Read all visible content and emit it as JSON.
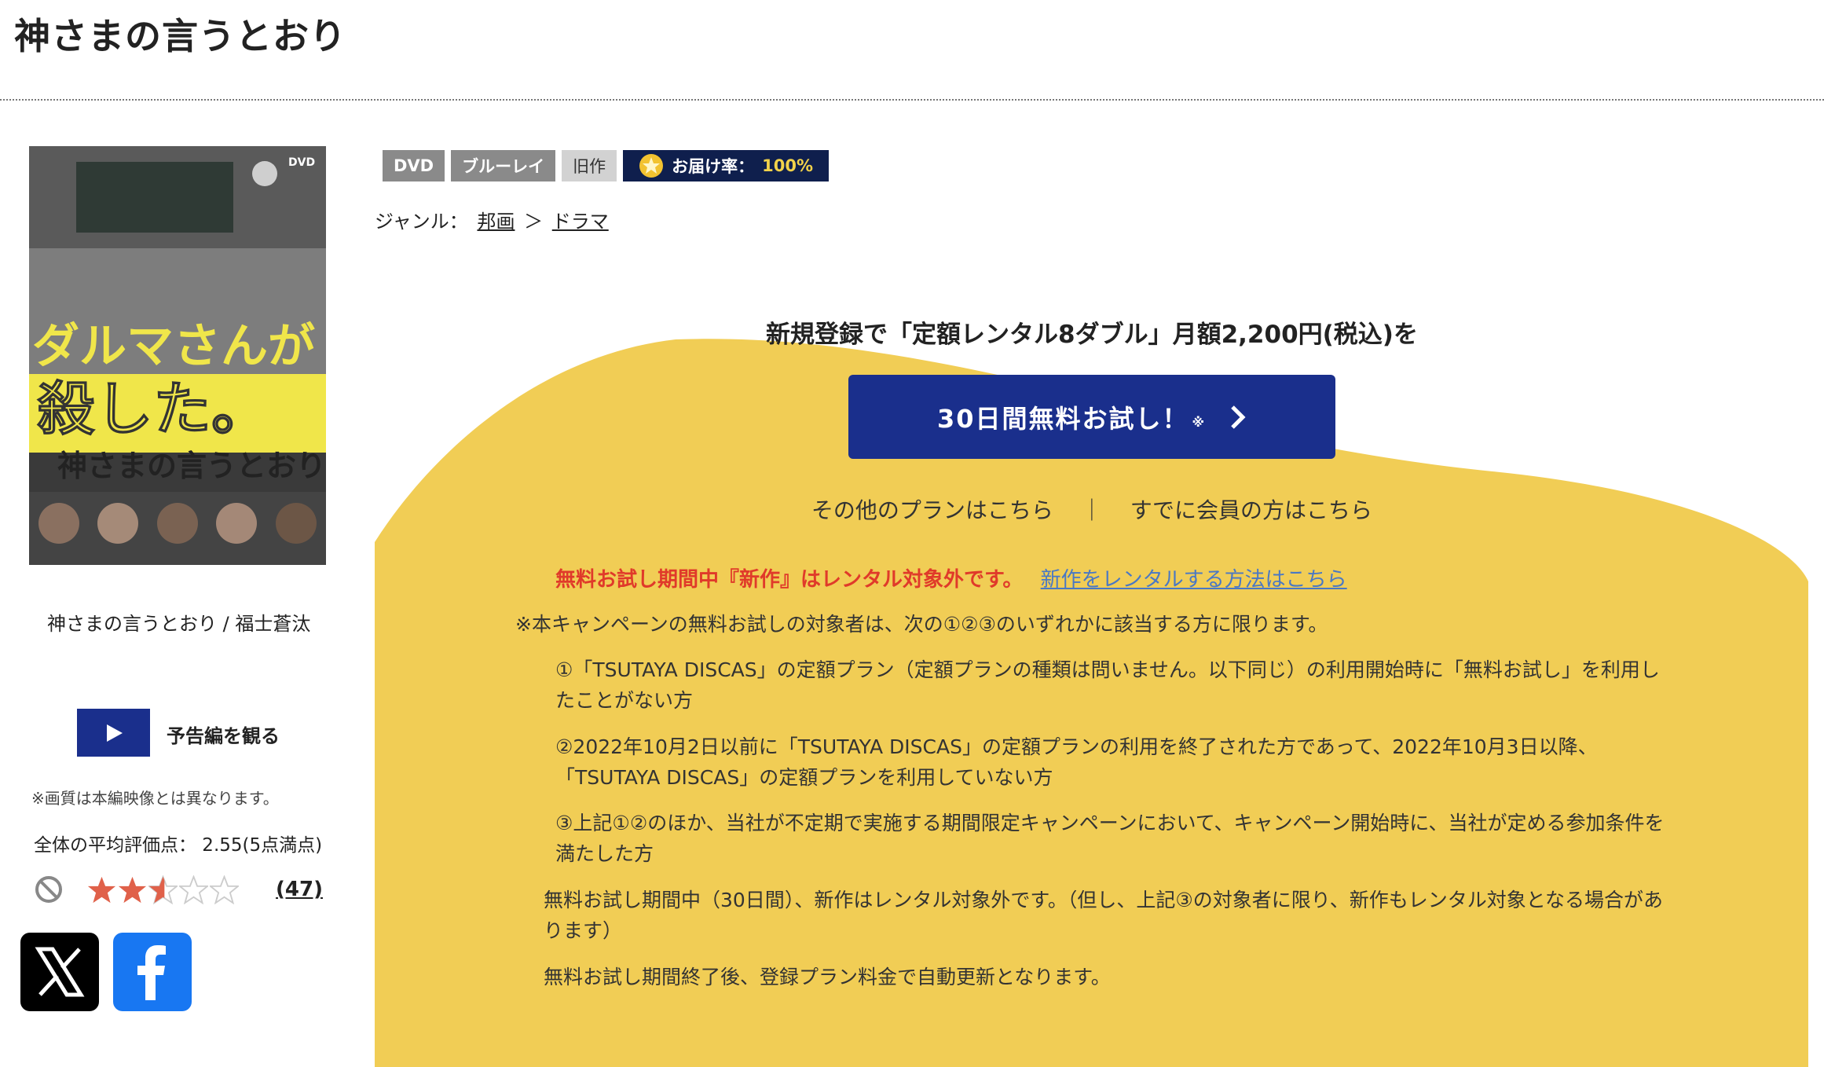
{
  "page": {
    "title": "神さまの言うとおり"
  },
  "product": {
    "cover_text_top": "ダルマさんが",
    "cover_text_bottom": "殺した。",
    "cover_subtitle": "神さまの言うとおり",
    "cover_logo": "DVD",
    "caption": "神さまの言うとおり / 福士蒼汰",
    "trailer_label": "予告編を観る",
    "quality_note": "※画質は本編映像とは異なります。",
    "avg_rating_text": "全体の平均評価点： 2.55(5点満点)",
    "rating_value": 2.55,
    "rating_max": 5,
    "review_count": "(47)"
  },
  "badges": {
    "dvd": "DVD",
    "bluray": "ブルーレイ",
    "old": "旧作",
    "delivery_label": "お届け率：",
    "delivery_pct": "100%"
  },
  "genre": {
    "label": "ジャンル：",
    "cat1": "邦画",
    "sep": "＞",
    "cat2": "ドラマ"
  },
  "promo": {
    "headline": "新規登録で「定額レンタル8ダブル」月額2,200円(税込)を",
    "cta_label": "30日間無料お試し！",
    "cta_mark": "※",
    "other_plans": "その他のプランはこちら",
    "separator": "｜",
    "member_link": "すでに会員の方はこちら",
    "notice_red": "無料お試し期間中『新作』はレンタル対象外です。",
    "notice_link": "新作をレンタルする方法はこちら",
    "terms_intro": "※本キャンペーンの無料お試しの対象者は、次の①②③のいずれかに該当する方に限ります。",
    "term1": "①「TSUTAYA DISCAS」の定額プラン（定額プランの種類は問いません。以下同じ）の利用開始時に「無料お試し」を利用したことがない方",
    "term2": "②2022年10月2日以前に「TSUTAYA DISCAS」の定額プランの利用を終了された方であって、2022年10月3日以降、「TSUTAYA DISCAS」の定額プランを利用していない方",
    "term3": "③上記①②のほか、当社が不定期で実施する期間限定キャンペーンにおいて、キャンペーン開始時に、当社が定める参加条件を満たした方",
    "term4": "無料お試し期間中（30日間）、新作はレンタル対象外です。（但し、上記③の対象者に限り、新作もレンタル対象となる場合があります）",
    "term5": "無料お試し期間終了後、登録プラン料金で自動更新となります。"
  },
  "colors": {
    "accent_blue": "#1a2f8c",
    "promo_yellow": "#f1cd55",
    "notice_red": "#e03a2a",
    "link_blue": "#4a78c4"
  }
}
